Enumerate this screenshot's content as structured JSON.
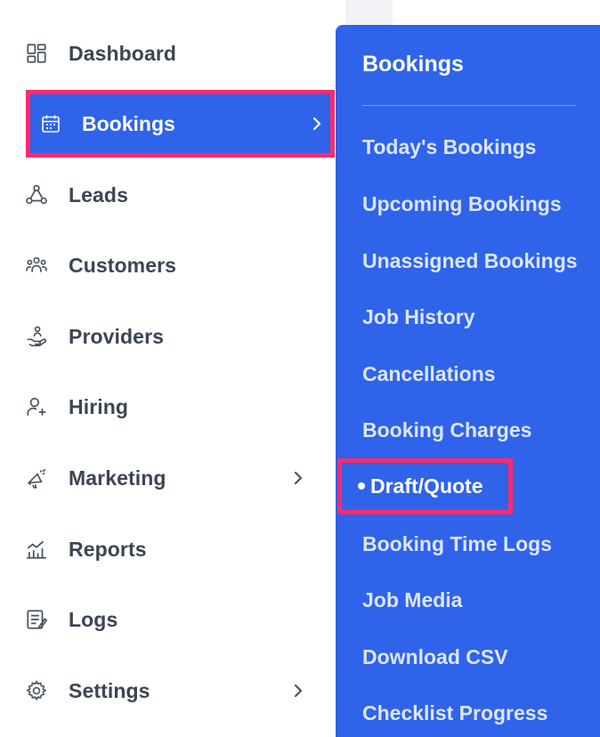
{
  "sidebar": {
    "items": [
      {
        "label": "Dashboard",
        "icon": "dashboard-icon"
      },
      {
        "label": "Bookings",
        "icon": "calendar-icon",
        "active": true
      },
      {
        "label": "Leads",
        "icon": "leads-icon"
      },
      {
        "label": "Customers",
        "icon": "customers-icon"
      },
      {
        "label": "Providers",
        "icon": "providers-icon"
      },
      {
        "label": "Hiring",
        "icon": "hiring-icon"
      },
      {
        "label": "Marketing",
        "icon": "megaphone-icon"
      },
      {
        "label": "Reports",
        "icon": "reports-icon"
      },
      {
        "label": "Logs",
        "icon": "logs-icon"
      },
      {
        "label": "Settings",
        "icon": "gear-icon"
      }
    ]
  },
  "submenu": {
    "title": "Bookings",
    "items": [
      {
        "label": "Today's Bookings"
      },
      {
        "label": "Upcoming Bookings"
      },
      {
        "label": "Unassigned Bookings"
      },
      {
        "label": "Job History"
      },
      {
        "label": "Cancellations"
      },
      {
        "label": "Booking Charges"
      },
      {
        "label": "Draft/Quote",
        "active": true
      },
      {
        "label": "Booking Time Logs"
      },
      {
        "label": "Job Media"
      },
      {
        "label": "Download CSV"
      },
      {
        "label": "Checklist Progress"
      }
    ]
  },
  "colors": {
    "accent": "#2f63ea",
    "highlight": "#ff2b6e",
    "text": "#3c4553",
    "submenu_text": "#dbe6ff"
  }
}
